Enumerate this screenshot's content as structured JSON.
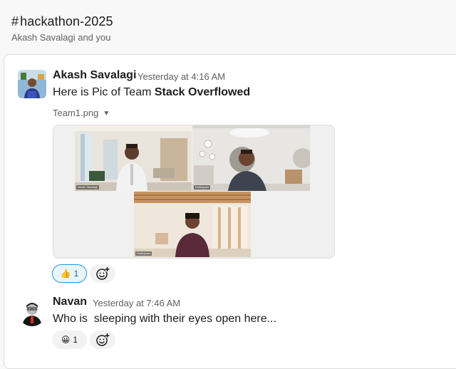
{
  "header": {
    "hash": "#",
    "channel_name": "hackathon-2025",
    "members": "Akash Savalagi and you"
  },
  "messages": [
    {
      "author": "Akash Savalagi",
      "time": "Yesterday at 4:16 AM",
      "text_prefix": "Here is Pic of Team ",
      "text_bold": "Stack Overflowed",
      "file": {
        "name": "Team1.png",
        "participant_labels": [
          "Akash Savalagi",
          "Participant",
          "Participant"
        ]
      },
      "reactions": [
        {
          "emoji": "thumbs-up",
          "glyph": "👍",
          "count": "1",
          "selected": true
        }
      ]
    },
    {
      "author": "Navan",
      "time": "Yesterday at 7:46 AM",
      "text": "Who is  sleeping with their eyes open here...",
      "reactions": [
        {
          "emoji": "grinning-face",
          "glyph": "😀",
          "count": "1",
          "selected": false
        }
      ]
    }
  ],
  "icons": {
    "add_reaction": "add-reaction-icon",
    "dropdown": "caret-down-icon"
  },
  "colors": {
    "selected_reaction_border": "#1d9bd1",
    "selected_reaction_bg": "#e8f5fa",
    "selected_reaction_text": "#1264a3",
    "text_primary": "#1d1c1d",
    "text_secondary": "#616061"
  }
}
